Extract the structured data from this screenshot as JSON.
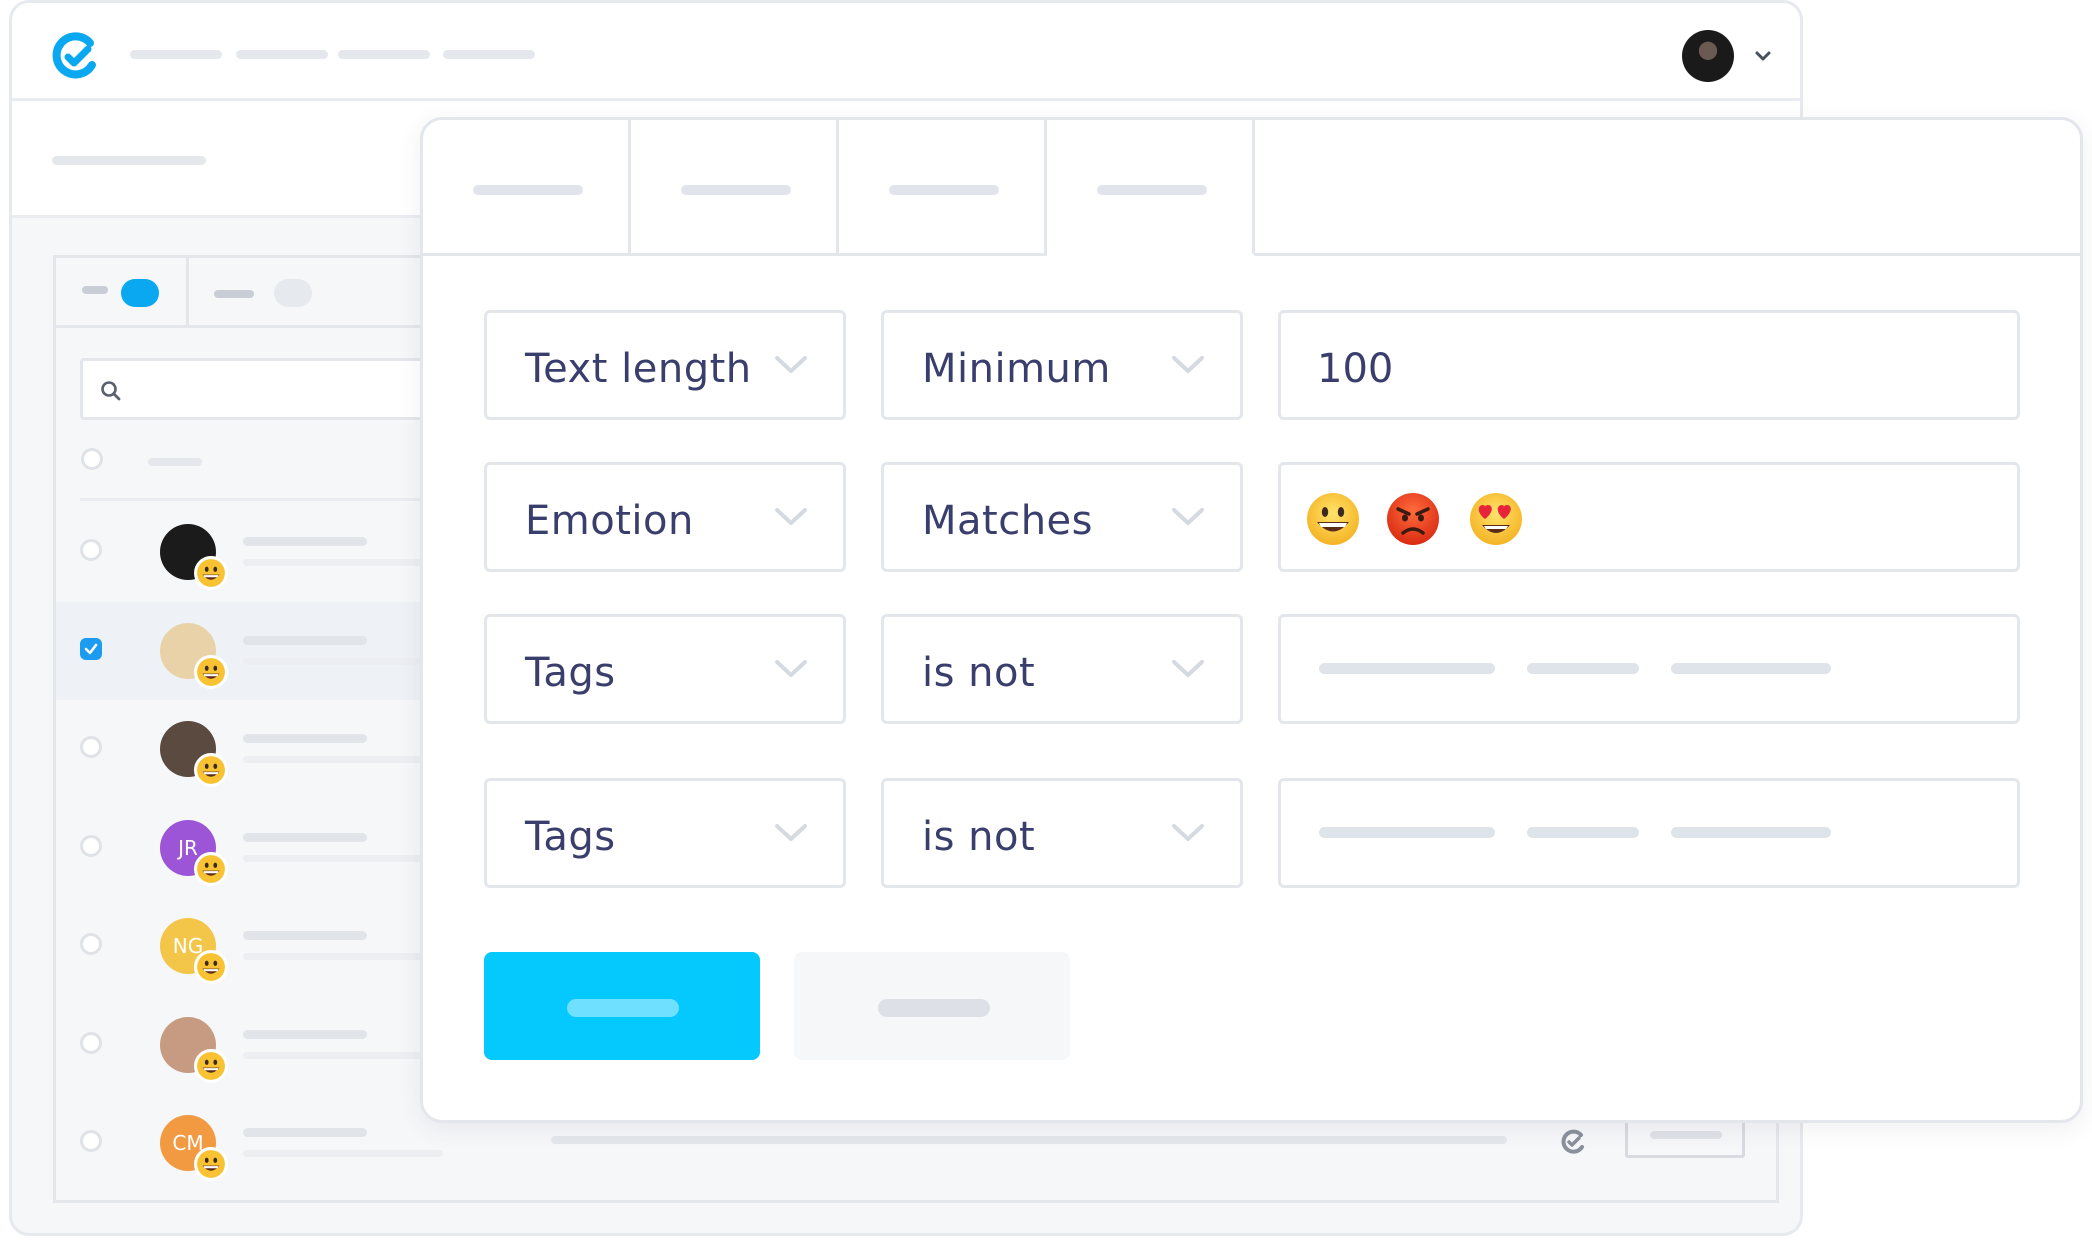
{
  "app": {
    "nav_placeholders": 4
  },
  "list": {
    "rows": [
      {
        "initials": "",
        "avatar_color": "#1b1b1b",
        "checked": false
      },
      {
        "initials": "",
        "avatar_color": "#e9d2a8",
        "checked": true
      },
      {
        "initials": "",
        "avatar_color": "#5b4a3f",
        "checked": false
      },
      {
        "initials": "JR",
        "avatar_color": "#9b55d6",
        "checked": false
      },
      {
        "initials": "NG",
        "avatar_color": "#f3c649",
        "checked": false
      },
      {
        "initials": "",
        "avatar_color": "#c79a82",
        "checked": false
      },
      {
        "initials": "CM",
        "avatar_color": "#f29a42",
        "checked": false
      }
    ]
  },
  "filter": {
    "rows": [
      {
        "field": "Text length",
        "operator": "Minimum",
        "value": "100"
      },
      {
        "field": "Emotion",
        "operator": "Matches",
        "value_icons": [
          "grinning-face-icon",
          "angry-face-icon",
          "heart-eyes-face-icon"
        ]
      },
      {
        "field": "Tags",
        "operator": "is not"
      },
      {
        "field": "Tags",
        "operator": "is not"
      }
    ]
  },
  "colors": {
    "accent": "#05c8fd",
    "brand": "#0aa8f0",
    "text": "#3a3e6c",
    "checkbox_checked": "#1c9cf0"
  }
}
